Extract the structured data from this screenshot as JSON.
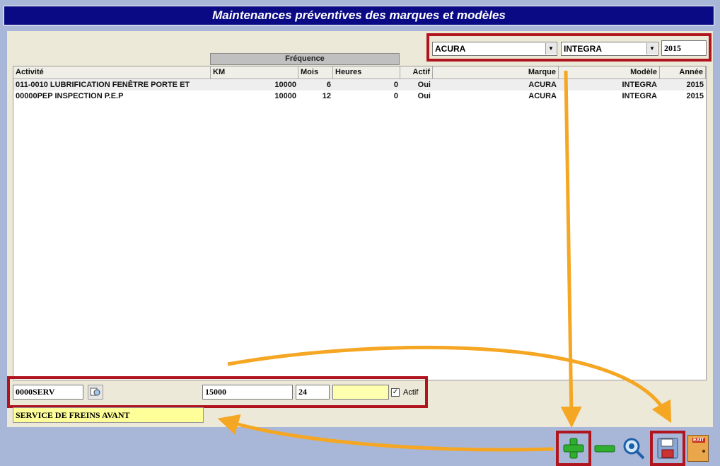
{
  "window": {
    "title": "Maintenances préventives des marques et modèles"
  },
  "filters": {
    "make": "ACURA",
    "model": "INTEGRA",
    "year": "2015"
  },
  "grid": {
    "group_header": "Fréquence",
    "columns": [
      "Activité",
      "KM",
      "Mois",
      "Heures",
      "Actif",
      "Marque",
      "Modèle",
      "Année"
    ],
    "rows": [
      {
        "activite": "011-0010 LUBRIFICATION FENÊTRE PORTE ET",
        "km": "10000",
        "mois": "6",
        "heures": "0",
        "actif": "Oui",
        "marque": "ACURA",
        "modele": "INTEGRA",
        "annee": "2015"
      },
      {
        "activite": "00000PEP INSPECTION P.E.P",
        "km": "10000",
        "mois": "12",
        "heures": "0",
        "actif": "Oui",
        "marque": "ACURA",
        "modele": "INTEGRA",
        "annee": "2015"
      }
    ]
  },
  "editor": {
    "activity_code": "0000SERV",
    "km": "15000",
    "mois": "24",
    "heures": "",
    "actif_label": "Actif",
    "actif_checked": true,
    "description": "SERVICE DE FREINS AVANT"
  },
  "toolbar": {
    "add_icon": "plus-icon",
    "remove_icon": "minus-icon",
    "search_icon": "magnifier-icon",
    "save_icon": "floppy-disk-icon",
    "exit_label": "EXIT"
  },
  "colors": {
    "title_bg": "#0a0a84",
    "highlight_border": "#b0141e",
    "arrow": "#f5a623",
    "description_bg": "#ffff99"
  }
}
